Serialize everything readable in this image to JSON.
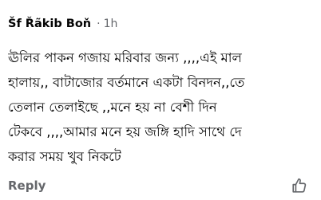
{
  "comment": {
    "author": "Šf Řãkib Boň",
    "separator": "·",
    "time": "1h",
    "body_lines": [
      "ঊলির পাকন গজায় মরিবার জন্য ,,,,এই মাল",
      "হালায়,, বাটাজোর বর্তমানে একটা বিনদন,,তে",
      "তেলান তেলাইছে ,,মনে হয় না বেশী দিন",
      "টেকবে ,,,,আমার মনে হয় জঙ্গি হাদি সাথে দে",
      "করার সময় খুব নিকটে"
    ]
  },
  "footer": {
    "reply_label": "Reply",
    "like_icon": "thumbs-up-outline-icon",
    "icon_color": "#65676b"
  }
}
